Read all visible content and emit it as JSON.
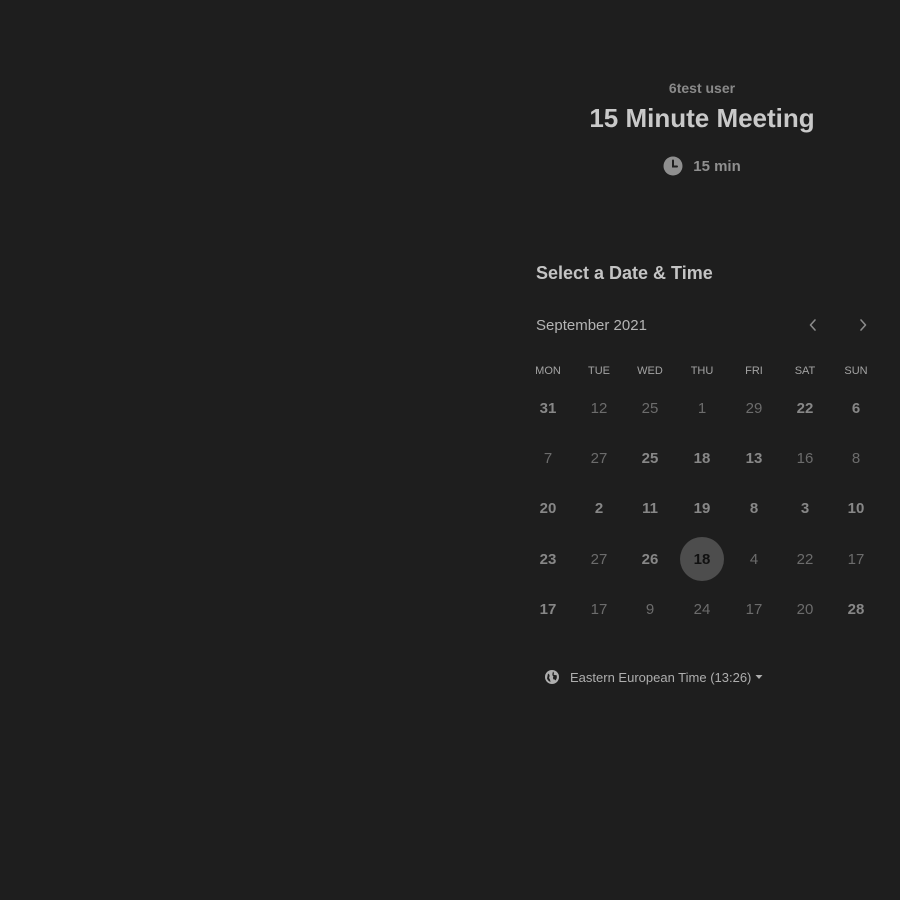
{
  "event": {
    "host_name": "6test user",
    "title": "15 Minute Meeting",
    "duration": "15 min",
    "duration_icon": "clock-icon"
  },
  "calendar": {
    "heading": "Select a Date & Time",
    "month_label": "September 2021",
    "prev_icon": "chevron-left-icon",
    "next_icon": "chevron-right-icon",
    "weekdays": [
      "MON",
      "TUE",
      "WED",
      "THU",
      "FRI",
      "SAT",
      "SUN"
    ],
    "weeks": [
      [
        {
          "label": "31",
          "available": true
        },
        {
          "label": "12",
          "available": false
        },
        {
          "label": "25",
          "available": false
        },
        {
          "label": "1",
          "available": false
        },
        {
          "label": "29",
          "available": false
        },
        {
          "label": "22",
          "available": true
        },
        {
          "label": "6",
          "available": true
        }
      ],
      [
        {
          "label": "7",
          "available": false
        },
        {
          "label": "27",
          "available": false
        },
        {
          "label": "25",
          "available": true
        },
        {
          "label": "18",
          "available": true
        },
        {
          "label": "13",
          "available": true
        },
        {
          "label": "16",
          "available": false
        },
        {
          "label": "8",
          "available": false
        }
      ],
      [
        {
          "label": "20",
          "available": true
        },
        {
          "label": "2",
          "available": true
        },
        {
          "label": "11",
          "available": true
        },
        {
          "label": "19",
          "available": true
        },
        {
          "label": "8",
          "available": true
        },
        {
          "label": "3",
          "available": true
        },
        {
          "label": "10",
          "available": true
        }
      ],
      [
        {
          "label": "23",
          "available": true
        },
        {
          "label": "27",
          "available": false
        },
        {
          "label": "26",
          "available": true
        },
        {
          "label": "18",
          "available": true,
          "selected": true
        },
        {
          "label": "4",
          "available": false
        },
        {
          "label": "22",
          "available": false
        },
        {
          "label": "17",
          "available": false
        }
      ],
      [
        {
          "label": "17",
          "available": true
        },
        {
          "label": "17",
          "available": false
        },
        {
          "label": "9",
          "available": false
        },
        {
          "label": "24",
          "available": false
        },
        {
          "label": "17",
          "available": false
        },
        {
          "label": "20",
          "available": false
        },
        {
          "label": "28",
          "available": true
        }
      ]
    ]
  },
  "timezone": {
    "label": "Eastern European Time (13:26)",
    "icon": "globe-icon",
    "dropdown_icon": "caret-down-icon"
  },
  "colors": {
    "background": "#1e1e1e",
    "selected_day_bg": "#4d4d4d"
  }
}
